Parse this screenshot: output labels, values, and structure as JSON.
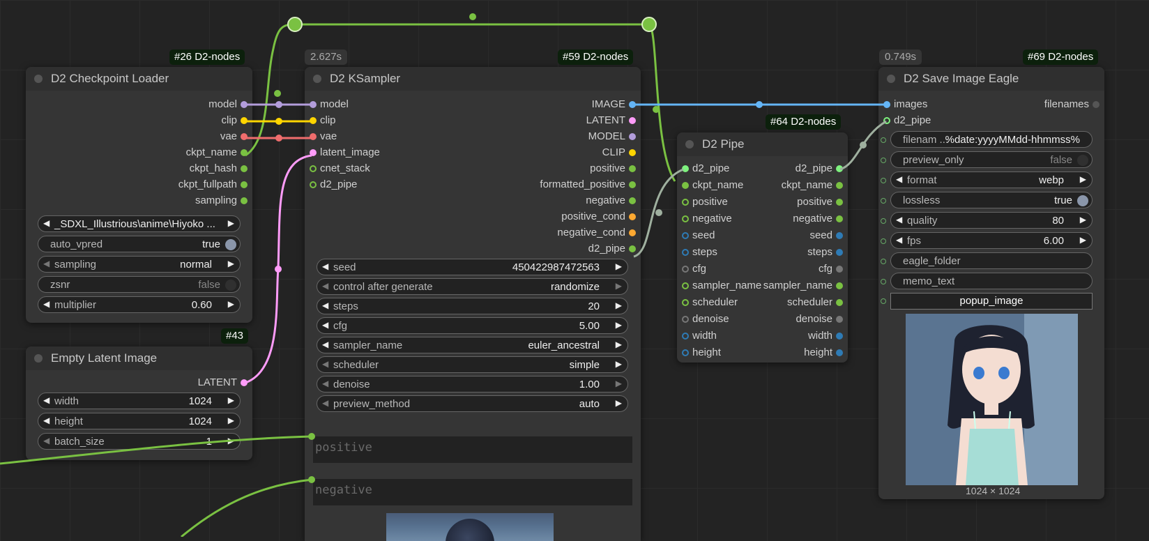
{
  "nodes": {
    "checkpoint": {
      "badge": "#26 D2-nodes",
      "title": "D2 Checkpoint Loader",
      "outputs": [
        "model",
        "clip",
        "vae",
        "ckpt_name",
        "ckpt_hash",
        "ckpt_fullpath",
        "sampling"
      ],
      "output_colors": [
        "#b39ddb",
        "#ffd500",
        "#f06d6d",
        "#7ac142",
        "#7ac142",
        "#7ac142",
        "#7ac142"
      ],
      "widgets": {
        "ckpt_value": "_SDXL_Illustrious\\anime\\Hiyoko ...",
        "auto_vpred_label": "auto_vpred",
        "auto_vpred_value": "true",
        "sampling_label": "sampling",
        "sampling_value": "normal",
        "zsnr_label": "zsnr",
        "zsnr_value": "false",
        "multiplier_label": "multiplier",
        "multiplier_value": "0.60"
      }
    },
    "latent": {
      "badge": "#43",
      "title": "Empty Latent Image",
      "output": "LATENT",
      "widgets": {
        "width_label": "width",
        "width_value": "1024",
        "height_label": "height",
        "height_value": "1024",
        "batch_label": "batch_size",
        "batch_value": "1"
      }
    },
    "ksampler": {
      "timer": "2.627s",
      "badge": "#59 D2-nodes",
      "title": "D2 KSampler",
      "inputs": [
        "model",
        "clip",
        "vae",
        "latent_image",
        "cnet_stack",
        "d2_pipe"
      ],
      "input_colors": [
        "#b39ddb",
        "#ffd500",
        "#f06d6d",
        "#ff9cf9",
        "#7ac142",
        "#7ac142"
      ],
      "outputs": [
        "IMAGE",
        "LATENT",
        "MODEL",
        "CLIP",
        "positive",
        "formatted_positive",
        "negative",
        "positive_cond",
        "negative_cond",
        "d2_pipe"
      ],
      "output_colors": [
        "#64b5f6",
        "#ff9cf9",
        "#b39ddb",
        "#ffd500",
        "#7ac142",
        "#7ac142",
        "#7ac142",
        "#ffa931",
        "#ffa931",
        "#7ac142"
      ],
      "widgets": [
        {
          "label": "seed",
          "value": "450422987472563"
        },
        {
          "label": "control after generate",
          "value": "randomize"
        },
        {
          "label": "steps",
          "value": "20"
        },
        {
          "label": "cfg",
          "value": "5.00"
        },
        {
          "label": "sampler_name",
          "value": "euler_ancestral"
        },
        {
          "label": "scheduler",
          "value": "simple"
        },
        {
          "label": "denoise",
          "value": "1.00"
        },
        {
          "label": "preview_method",
          "value": "auto"
        }
      ],
      "positive_placeholder": "positive",
      "negative_placeholder": "negative"
    },
    "pipe": {
      "badge": "#64 D2-nodes",
      "title": "D2 Pipe",
      "inputs": [
        "d2_pipe",
        "ckpt_name",
        "positive",
        "negative",
        "seed",
        "steps",
        "cfg",
        "sampler_name",
        "scheduler",
        "denoise",
        "width",
        "height"
      ],
      "outputs": [
        "d2_pipe",
        "ckpt_name",
        "positive",
        "negative",
        "seed",
        "steps",
        "cfg",
        "sampler_name",
        "scheduler",
        "denoise",
        "width",
        "height"
      ],
      "colors": [
        "#7ef27e",
        "#7ac142",
        "#7ac142",
        "#7ac142",
        "#2e7bb5",
        "#2e7bb5",
        "#777777",
        "#7ac142",
        "#7ac142",
        "#777777",
        "#2e7bb5",
        "#2e7bb5"
      ]
    },
    "save": {
      "timer": "0.749s",
      "badge": "#69 D2-nodes",
      "title": "D2 Save Image Eagle",
      "inputs": [
        "images",
        "d2_pipe"
      ],
      "outputs": [
        "filenames"
      ],
      "widgets": {
        "filename_label": "filenam ...",
        "filename_value": "%date:yyyyMMdd-hhmmss%",
        "preview_only_label": "preview_only",
        "preview_only_value": "false",
        "format_label": "format",
        "format_value": "webp",
        "lossless_label": "lossless",
        "lossless_value": "true",
        "quality_label": "quality",
        "quality_value": "80",
        "fps_label": "fps",
        "fps_value": "6.00",
        "eagle_folder_label": "eagle_folder",
        "memo_text_label": "memo_text",
        "popup_label": "popup_image"
      },
      "image_caption": "1024 × 1024"
    }
  },
  "colors": {
    "model": "#b39ddb",
    "clip": "#ffd500",
    "vae": "#f06d6d",
    "latent": "#ff9cf9",
    "image": "#64b5f6",
    "string": "#7ac142",
    "pipe": "#9fb09f",
    "conditioning": "#ffa931"
  }
}
